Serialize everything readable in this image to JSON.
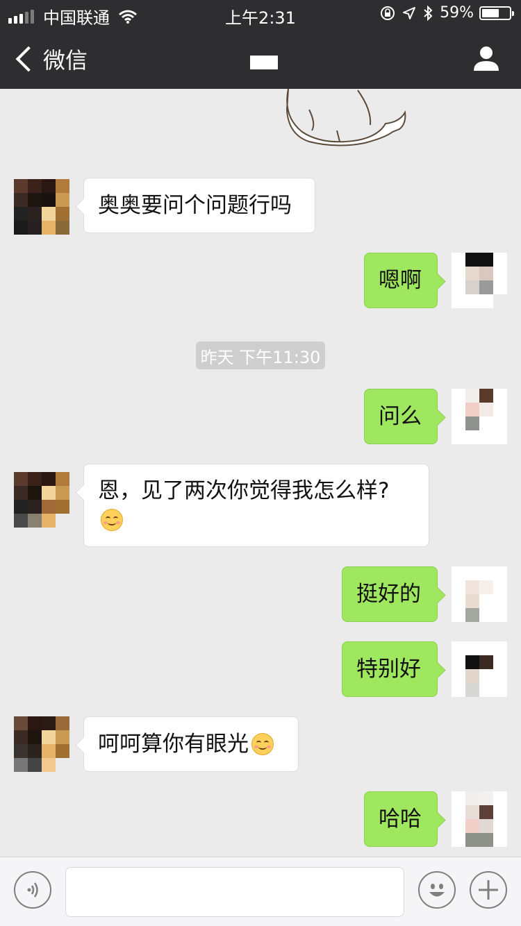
{
  "status_bar": {
    "carrier": "中国联通",
    "time": "上午2:31",
    "battery": "59%",
    "icons": [
      "signal-icon",
      "wifi-icon",
      "orientation-lock-icon",
      "location-icon",
      "bluetooth-icon",
      "battery-icon"
    ]
  },
  "nav": {
    "back_label": "微信",
    "title": "",
    "icons": [
      "back-chevron-icon",
      "profile-icon"
    ]
  },
  "messages": [
    {
      "side": "left",
      "text": "奥奥要问个问题行吗"
    },
    {
      "side": "right",
      "text": "嗯啊"
    },
    {
      "side": "right",
      "text": "问么"
    },
    {
      "side": "left",
      "text": "恩，见了两次你觉得我怎么样?"
    },
    {
      "side": "right",
      "text": "挺好的"
    },
    {
      "side": "right",
      "text": "特别好"
    },
    {
      "side": "left",
      "text": "呵呵算你有眼光"
    },
    {
      "side": "right",
      "text": "哈哈"
    }
  ],
  "timestamp": "昨天 下午11:30",
  "input_bar": {
    "icons": [
      "voice-icon",
      "emoji-icon",
      "plus-icon"
    ],
    "input_value": ""
  },
  "colors": {
    "bar_bg": "#2e2e30",
    "chat_bg": "#ebebeb",
    "bubble_mine": "#9fe75f",
    "bubble_theirs": "#ffffff"
  }
}
